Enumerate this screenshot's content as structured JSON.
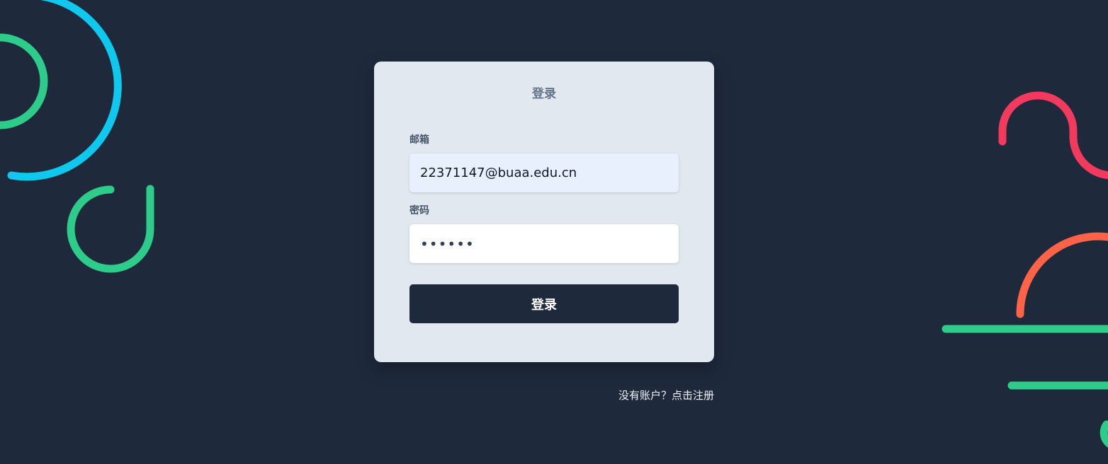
{
  "login_card": {
    "title": "登录",
    "email_label": "邮箱",
    "email_value": "22371147@buaa.edu.cn",
    "password_label": "密码",
    "password_value": "••••••",
    "submit_label": "登录"
  },
  "register": {
    "link_text": "没有账户？点击注册"
  },
  "colors": {
    "background": "#1e293b",
    "card": "#e2e8f0",
    "button": "#1e293b",
    "deco_cyan": "#0ec8ee",
    "deco_green": "#2ecc8a",
    "deco_red": "#f23a5e",
    "deco_orange": "#ff6347"
  }
}
